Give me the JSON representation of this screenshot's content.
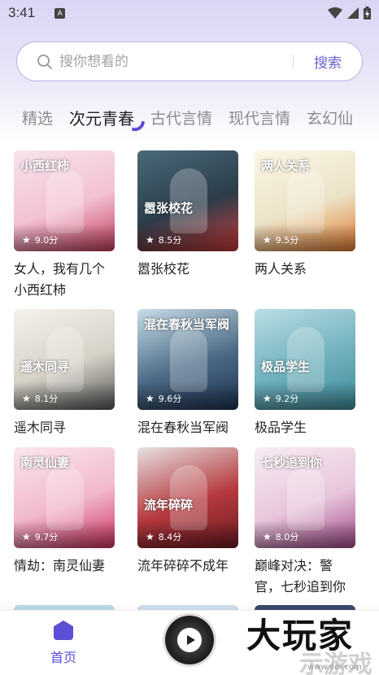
{
  "status_bar": {
    "time": "3:41",
    "notification_badge": "A"
  },
  "search": {
    "placeholder": "搜你想看的",
    "button_label": "搜索"
  },
  "tabs": [
    {
      "label": "精选",
      "active": false
    },
    {
      "label": "次元青春",
      "active": true
    },
    {
      "label": "古代言情",
      "active": false
    },
    {
      "label": "现代言情",
      "active": false
    },
    {
      "label": "玄幻仙",
      "active": false
    }
  ],
  "books": [
    {
      "title": "女人，我有几个小西红柿",
      "rating": "9.0分",
      "cover_text": "小西红柿",
      "cover_colors": [
        "#f7e4ec",
        "#f3c1d4",
        "#c43d5b"
      ]
    },
    {
      "title": "嚣张校花",
      "rating": "8.5分",
      "cover_text": "嚣张校花",
      "cover_colors": [
        "#4b6a7a",
        "#2b3d4a",
        "#c53a3a"
      ]
    },
    {
      "title": "两人关系",
      "rating": "9.5分",
      "cover_text": "两人关系",
      "cover_colors": [
        "#fbf6e6",
        "#ece3c7",
        "#e07a2e"
      ]
    },
    {
      "title": "遥木同寻",
      "rating": "8.1分",
      "cover_text": "遥木同寻",
      "cover_colors": [
        "#f4f2ec",
        "#d7d2c8",
        "#555555"
      ]
    },
    {
      "title": "混在春秋当军阀",
      "rating": "9.6分",
      "cover_text": "混在春秋当军阀",
      "cover_colors": [
        "#c7dde8",
        "#4d6b86",
        "#1e3352"
      ]
    },
    {
      "title": "极品学生",
      "rating": "9.2分",
      "cover_text": "极品学生",
      "cover_colors": [
        "#b9dde4",
        "#6fb0bc",
        "#3f8a9a"
      ]
    },
    {
      "title": "情劫：南灵仙妻",
      "rating": "9.7分",
      "cover_text": "南灵仙妻",
      "cover_colors": [
        "#fbe7ee",
        "#f1b8cd",
        "#d0315f"
      ]
    },
    {
      "title": "流年碎碎不成年",
      "rating": "8.4分",
      "cover_text": "流年碎碎",
      "cover_colors": [
        "#e6e1e1",
        "#b63a3f",
        "#6e1c22"
      ]
    },
    {
      "title": "巅峰对决：警官，七秒追到你",
      "rating": "8.0分",
      "cover_text": "七秒追到你",
      "cover_colors": [
        "#f7ecf3",
        "#e8c6dc",
        "#a24a8a"
      ]
    }
  ],
  "bottom_nav": {
    "home_label": "首页"
  },
  "watermark": {
    "text": "大玩家",
    "sub": "示游戏",
    "url": "www.6dl.com"
  },
  "colors": {
    "accent": "#5a4fd6",
    "search_button": "#6a63d0"
  }
}
